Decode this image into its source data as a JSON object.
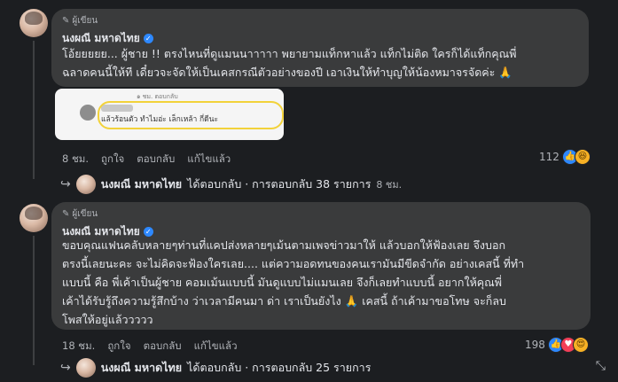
{
  "comments": [
    {
      "badge": "ผู้เขียน",
      "author": "นงผณี มหาดไทย",
      "text_lines": [
        "โอ้ยยยยย... ผู้ชาย !! ตรงไหนที่ดูแมนนาาาาา พยายามแท็กหาแล้ว แท็กไม่ติด ใครก็ได้แท็กคุณพี่",
        "ฉลาดคนนี้ให้ที เดี๋ยวจะจัดให้เป็นเคสกรณีตัวอย่างของปี เอาเงินให้ทำบุญให้น้องหมาจรจัดค่ะ 🙏"
      ],
      "screenshot": {
        "header": "๑ ชม.   ตอบกลับ",
        "text": "แล้วร้อนตัว ทำไมอ่ะ เล็กเหล้า กี่ดีนะ"
      },
      "time": "8 ชม.",
      "like": "ถูกใจ",
      "reply": "ตอบกลับ",
      "edited": "แก้ไขแล้ว",
      "reaction_count": "112",
      "replies_row": {
        "who": "นงผณี มหาดไทย",
        "action": "ได้ตอบกลับ · การตอบกลับ 38 รายการ",
        "time": "8 ชม."
      }
    },
    {
      "badge": "ผู้เขียน",
      "author": "นงผณี มหาดไทย",
      "text_lines": [
        "ขอบคุณแฟนคลับหลายๆท่านที่แคปส่งหลายๆเม้นตามเพจข่าวมาให้ แล้วบอกให้ฟ้องเลย จึงบอก",
        "ตรงนี้เลยนะคะ จะไม่คิดจะฟ้องใครเลย.... แต่ความอดทนของคนเรามันมีขีดจำกัด อย่างเคสนี้ ที่ทำ",
        "แบบนี้ คือ พี่เค้าเป็นผู้ชาย คอมเม้นแบบนี้ มันดูแบบไม่แมนเลย จึงก็เลยทำแบบนี้ อยากให้คุณพี่",
        "เค้าได้รับรู้ถึงความรู้สึกบ้าง ว่าเวลามีคนมา ด่า เราเป็นยังไง 🙏 เคสนี้ ถ้าเค้ามาขอโทษ จะก็ลบ",
        "โพสให้อยู่แล้ววววว"
      ],
      "time": "18 ชม.",
      "like": "ถูกใจ",
      "reply": "ตอบกลับ",
      "edited": "แก้ไขแล้ว",
      "reaction_count": "198",
      "replies_row": {
        "who": "นงผณี มหาดไทย",
        "action": "ได้ตอบกลับ · การตอบกลับ 25 รายการ",
        "time": ""
      }
    }
  ],
  "icons": {
    "pen": "pencil-icon",
    "verified": "verified-badge-icon",
    "reply_arrow": "reply-arrow-icon",
    "expand": "expand-icon"
  },
  "colors": {
    "background": "#1c1e21",
    "bubble": "#3a3b3c",
    "like": "#2d88ff",
    "love": "#f33e58",
    "haha": "#f7b125",
    "highlight": "#f2d23a"
  }
}
